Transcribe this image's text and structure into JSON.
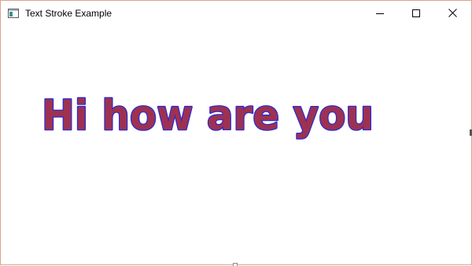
{
  "window": {
    "title": "Text Stroke Example",
    "app_icon": "window-app-icon",
    "controls": {
      "minimize_icon": "minimize-icon",
      "maximize_icon": "maximize-icon",
      "close_icon": "close-icon"
    },
    "border_color": "#d8a48f"
  },
  "canvas": {
    "text": "Hi how are you",
    "fill_color": "#9e3151",
    "stroke_color": "#2b2bd1"
  }
}
